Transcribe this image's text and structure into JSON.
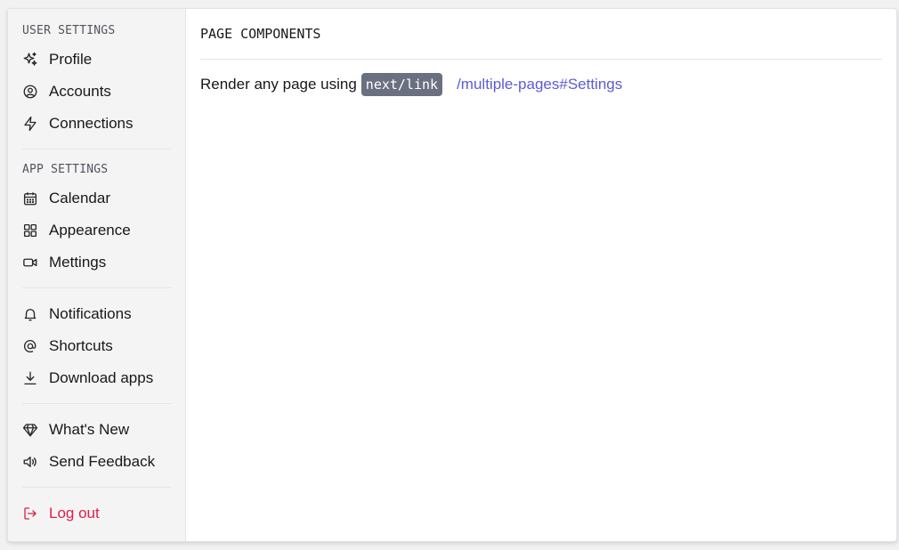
{
  "sidebar": {
    "sections": [
      {
        "title": "USER SETTINGS"
      },
      {
        "title": "APP SETTINGS"
      }
    ],
    "items": [
      {
        "label": "Profile",
        "icon": "sparkles-icon"
      },
      {
        "label": "Accounts",
        "icon": "user-circle-icon"
      },
      {
        "label": "Connections",
        "icon": "lightning-icon"
      },
      {
        "label": "Calendar",
        "icon": "calendar-icon"
      },
      {
        "label": "Appearence",
        "icon": "grid-icon"
      },
      {
        "label": "Mettings",
        "icon": "video-icon"
      },
      {
        "label": "Notifications",
        "icon": "bell-icon"
      },
      {
        "label": "Shortcuts",
        "icon": "at-icon"
      },
      {
        "label": "Download apps",
        "icon": "download-icon"
      },
      {
        "label": "What's New",
        "icon": "diamond-icon"
      },
      {
        "label": "Send Feedback",
        "icon": "speaker-icon"
      },
      {
        "label": "Log out",
        "icon": "logout-icon"
      }
    ]
  },
  "main": {
    "title": "PAGE COMPONENTS",
    "render_text": "Render any page using",
    "code": "next/link",
    "link": "/multiple-pages#Settings"
  },
  "colors": {
    "link": "#5b5bd6",
    "danger": "#e11d48",
    "code_bg": "#6b7080"
  }
}
